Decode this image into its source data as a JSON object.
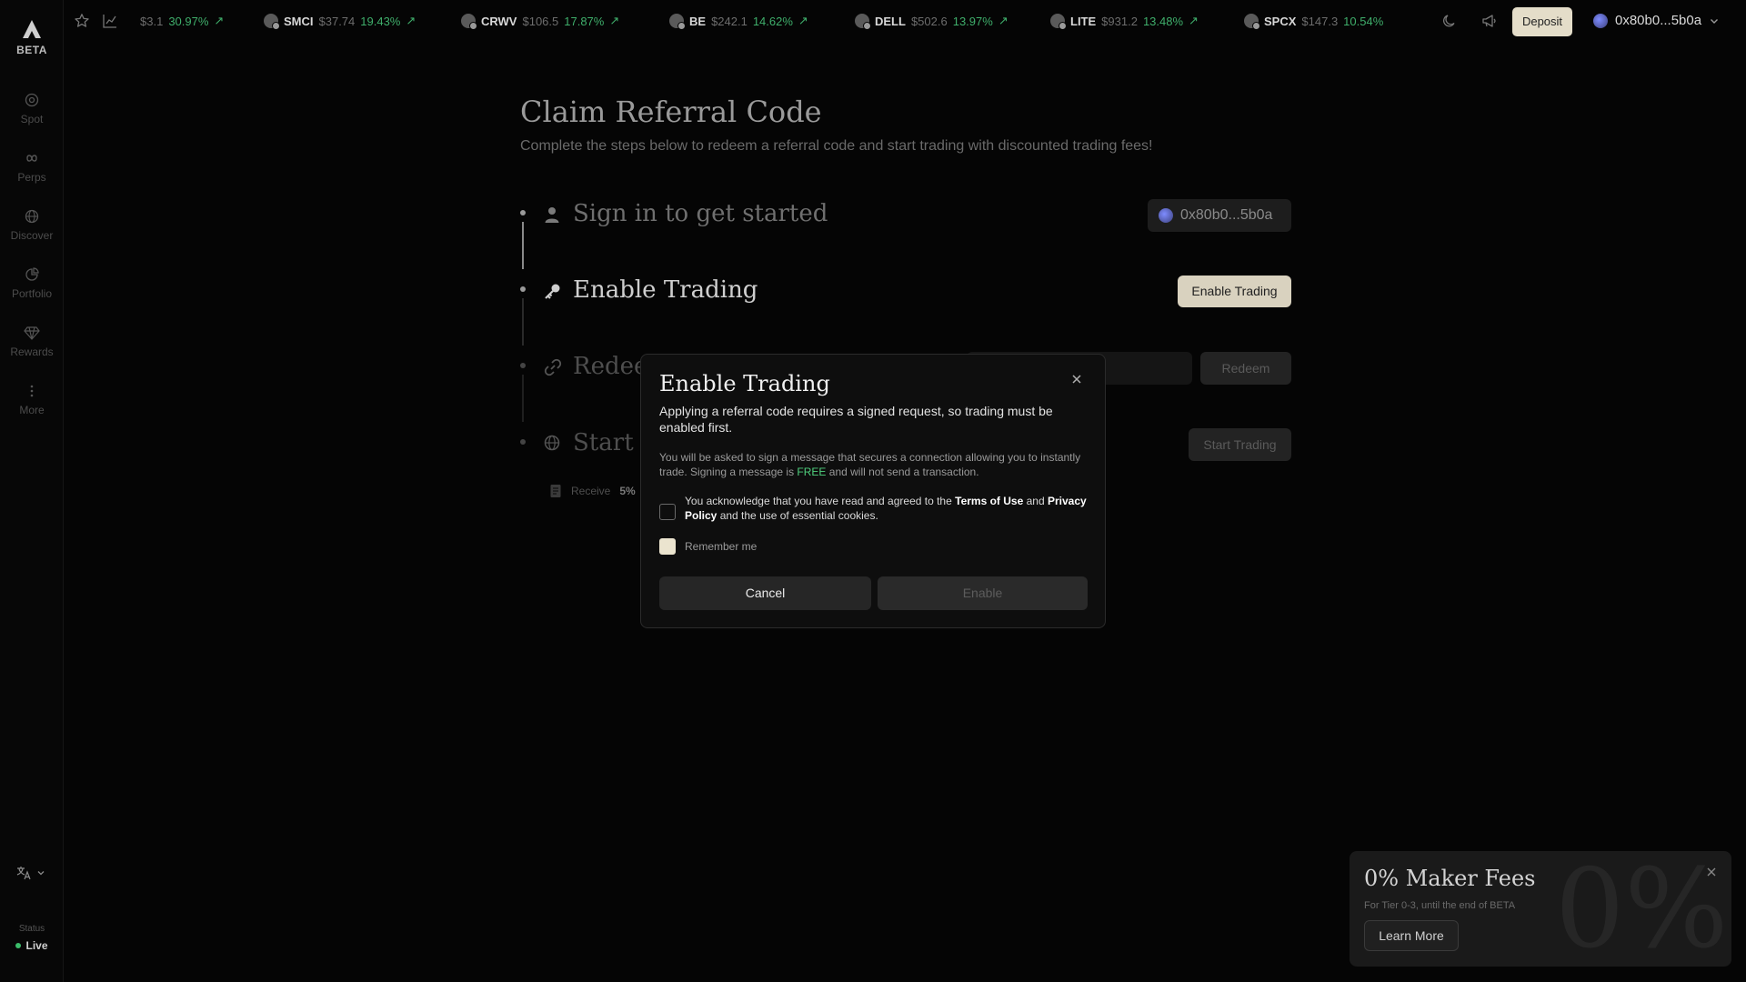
{
  "sidebar": {
    "logo_text": "BETA",
    "items": [
      {
        "label": "Spot",
        "icon": "spot-icon"
      },
      {
        "label": "Perps",
        "icon": "infinity-icon"
      },
      {
        "label": "Discover",
        "icon": "globe-icon"
      },
      {
        "label": "Portfolio",
        "icon": "pie-chart-icon"
      },
      {
        "label": "Rewards",
        "icon": "diamond-icon"
      },
      {
        "label": "More",
        "icon": "more-dots-icon"
      }
    ],
    "status_label": "Status",
    "status_value": "Live"
  },
  "topbar": {
    "tickers": [
      {
        "symbol": "",
        "price": "$3.1",
        "change": "30.97%"
      },
      {
        "symbol": "SMCI",
        "price": "$37.74",
        "change": "19.43%"
      },
      {
        "symbol": "CRWV",
        "price": "$106.5",
        "change": "17.87%"
      },
      {
        "symbol": "BE",
        "price": "$242.1",
        "change": "14.62%"
      },
      {
        "symbol": "DELL",
        "price": "$502.6",
        "change": "13.97%"
      },
      {
        "symbol": "LITE",
        "price": "$931.2",
        "change": "13.48%"
      },
      {
        "symbol": "SPCX",
        "price": "$147.3",
        "change": "10.54%"
      }
    ],
    "deposit_label": "Deposit",
    "wallet_address": "0x80b0...5b0a"
  },
  "page": {
    "title": "Claim Referral Code",
    "subtitle": "Complete the steps below to redeem a referral code and start trading with discounted trading fees!",
    "steps": [
      {
        "title": "Sign in to get started"
      },
      {
        "title": "Enable Trading"
      },
      {
        "title": "Redeem"
      },
      {
        "title": "Start tr"
      }
    ],
    "wallet_pill": "0x80b0...5b0a",
    "enable_trading_button": "Enable Trading",
    "redeem_button": "Redeem",
    "start_trading_button": "Start Trading",
    "receive_prefix": "Receive",
    "receive_value": "5%"
  },
  "modal": {
    "title": "Enable Trading",
    "description": "Applying a referral code requires a signed request, so trading must be enabled first.",
    "note_part1": "You will be asked to sign a message that secures a connection allowing you to instantly trade. Signing a message is ",
    "note_free": "FREE",
    "note_part2": " and will not send a transaction.",
    "ack_part1": "You acknowledge that you have read and agreed to the ",
    "ack_terms": "Terms of Use",
    "ack_and": " and ",
    "ack_privacy": "Privacy Policy",
    "ack_part2": " and the use of essential cookies.",
    "ack_checked": false,
    "remember_label": "Remember me",
    "remember_checked": true,
    "cancel_label": "Cancel",
    "enable_label": "Enable"
  },
  "promo": {
    "title": "0% Maker Fees",
    "subtitle": "For Tier 0-3, until the end of BETA",
    "button": "Learn More",
    "background_text": "0%"
  }
}
